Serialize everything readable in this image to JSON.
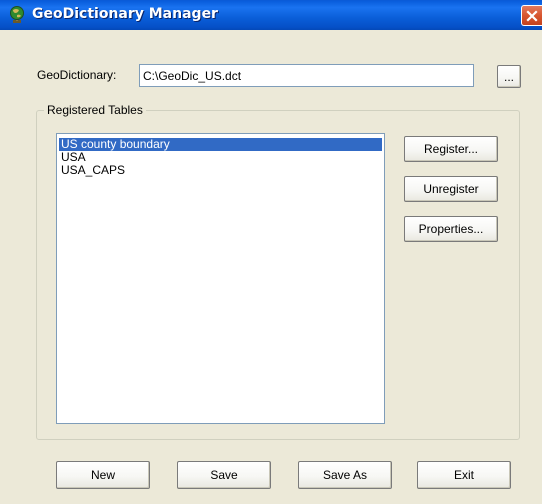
{
  "window": {
    "title": "GeoDictionary Manager",
    "title_icon": "globe-icon",
    "close_icon": "close-icon"
  },
  "geodictionary": {
    "label": "GeoDictionary:",
    "path": "C:\\GeoDic_US.dct",
    "browse_label": "..."
  },
  "registered_tables": {
    "group_label": "Registered Tables",
    "items": [
      {
        "label": "US county boundary",
        "selected": true
      },
      {
        "label": "USA",
        "selected": false
      },
      {
        "label": "USA_CAPS",
        "selected": false
      }
    ],
    "register_label": "Register...",
    "unregister_label": "Unregister",
    "properties_label": "Properties..."
  },
  "footer": {
    "new_label": "New",
    "save_label": "Save",
    "save_as_label": "Save As",
    "exit_label": "Exit"
  },
  "colors": {
    "title_bar": "#0a5ed8",
    "selection": "#316ac5",
    "dialog_bg": "#ece9d8",
    "close_button": "#d8562f"
  }
}
